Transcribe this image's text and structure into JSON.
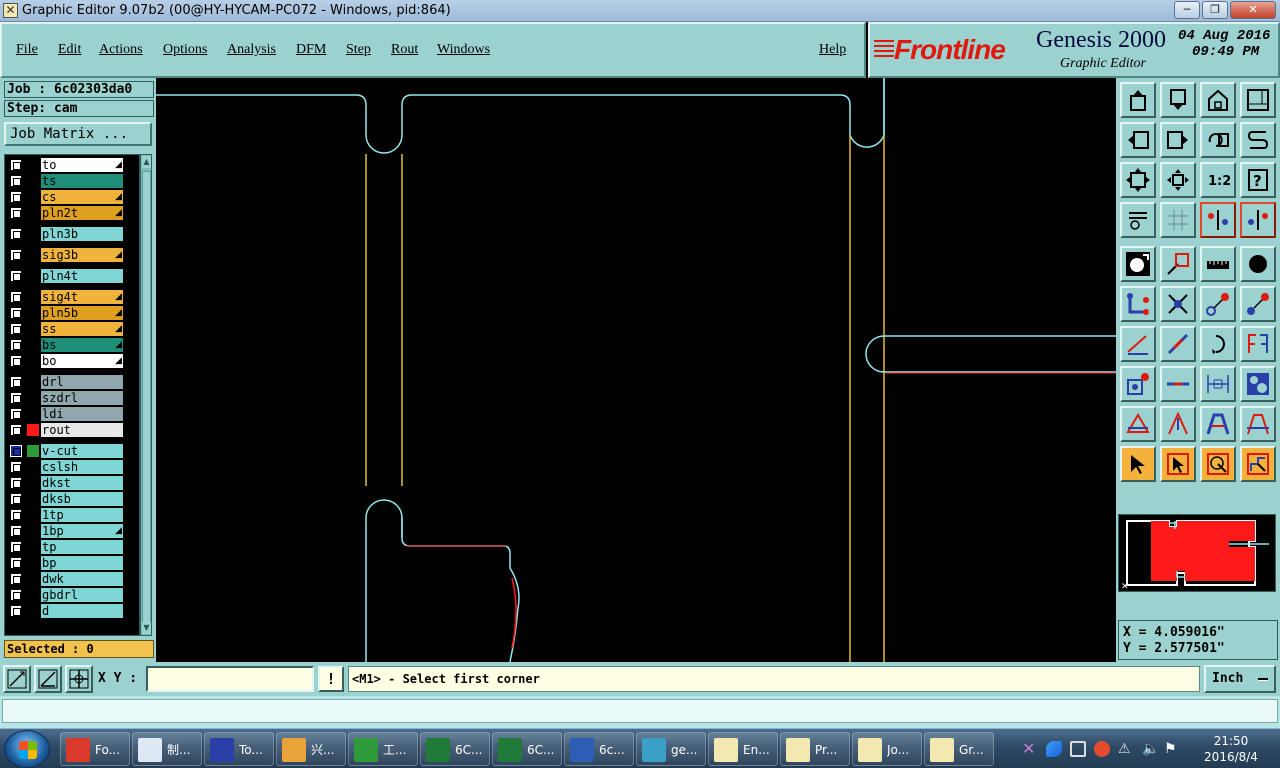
{
  "window": {
    "title": "Graphic Editor 9.07b2 (00@HY-HYCAM-PC072 - Windows, pid:864)",
    "controls": [
      "minimize",
      "maximize",
      "close"
    ]
  },
  "menu": {
    "file": "File",
    "edit": "Edit",
    "actions": "Actions",
    "options": "Options",
    "analysis": "Analysis",
    "dfm": "DFM",
    "step": "Step",
    "rout": "Rout",
    "windows": "Windows",
    "help": "Help"
  },
  "logo": {
    "brand": "Frontline",
    "product": "Genesis 2000",
    "subtitle": "Graphic Editor",
    "date": "04 Aug 2016",
    "time": "09:49 PM"
  },
  "job": {
    "job_line": "Job : 6c02303da0",
    "step_line": "Step: cam",
    "matrix_button": "Job Matrix ..."
  },
  "layers": [
    {
      "name": "to",
      "color": "#ffffff",
      "flag": true
    },
    {
      "name": "ts",
      "color": "#1f8f7a",
      "flag": false
    },
    {
      "name": "cs",
      "color": "#f0b43c",
      "flag": true
    },
    {
      "name": "pln2t",
      "color": "#e0a01f",
      "flag": true
    },
    {
      "name": "pln3b",
      "color": "#7fd6d4",
      "flag": false
    },
    {
      "name": "sig3b",
      "color": "#f0b43c",
      "flag": true
    },
    {
      "name": "pln4t",
      "color": "#7fd6d4",
      "flag": false
    },
    {
      "name": "sig4t",
      "color": "#f0b43c",
      "flag": true
    },
    {
      "name": "pln5b",
      "color": "#e0a01f",
      "flag": true
    },
    {
      "name": "ss",
      "color": "#f0b43c",
      "flag": true
    },
    {
      "name": "bs",
      "color": "#1f8f7a",
      "flag": true
    },
    {
      "name": "bo",
      "color": "#ffffff",
      "flag": true
    },
    {
      "name": "drl",
      "color": "#8fa7ad",
      "flag": false
    },
    {
      "name": "szdrl",
      "color": "#8fa7ad",
      "flag": false
    },
    {
      "name": "ldi",
      "color": "#8fa7ad",
      "flag": false
    },
    {
      "name": "rout",
      "color": "#e8e8e8",
      "flag": false,
      "mark": "#ff1a1a"
    },
    {
      "name": "v-cut",
      "color": "#7fd6d4",
      "flag": false,
      "mark": "#2f9a3a",
      "selected": true
    },
    {
      "name": "cslsh",
      "color": "#7fd6d4",
      "flag": false
    },
    {
      "name": "dkst",
      "color": "#7fd6d4",
      "flag": false
    },
    {
      "name": "dksb",
      "color": "#7fd6d4",
      "flag": false
    },
    {
      "name": "1tp",
      "color": "#7fd6d4",
      "flag": false
    },
    {
      "name": "1bp",
      "color": "#7fd6d4",
      "flag": true
    },
    {
      "name": "tp",
      "color": "#7fd6d4",
      "flag": false
    },
    {
      "name": "bp",
      "color": "#7fd6d4",
      "flag": false
    },
    {
      "name": "dwk",
      "color": "#7fd6d4",
      "flag": false
    },
    {
      "name": "gbdrl",
      "color": "#7fd6d4",
      "flag": false
    },
    {
      "name": "d",
      "color": "#7fd6d4",
      "flag": false
    }
  ],
  "selected_text": "Selected : 0",
  "coords": {
    "x_line": "X = 4.059016\"",
    "y_line": "Y = 2.577501\""
  },
  "status": {
    "xy_label": "X Y :",
    "xy_value": "",
    "excl_label": "!",
    "prompt": "<M1> - Select first corner",
    "unit": "Inch"
  },
  "taskbar": {
    "tasks": [
      {
        "label": "Fo...",
        "color": "#d93a2b"
      },
      {
        "label": "制...",
        "color": "#dfe9f5"
      },
      {
        "label": "To...",
        "color": "#2a3fa8"
      },
      {
        "label": "兴...",
        "color": "#e8a33a"
      },
      {
        "label": "工...",
        "color": "#2f9a3a"
      },
      {
        "label": "6C...",
        "color": "#1f7a3a"
      },
      {
        "label": "6C...",
        "color": "#1f7a3a"
      },
      {
        "label": "6c...",
        "color": "#2b5fb5"
      },
      {
        "label": "ge...",
        "color": "#3aa0c8"
      },
      {
        "label": "En...",
        "color": "#f3e8b0"
      },
      {
        "label": "Pr...",
        "color": "#f3e8b0"
      },
      {
        "label": "Jo...",
        "color": "#f3e8b0"
      },
      {
        "label": "Gr...",
        "color": "#f3e8b0"
      }
    ],
    "clock_time": "21:50",
    "clock_date": "2016/8/4"
  },
  "colors": {
    "panel": "#9bd2cf",
    "canvas_bg": "#000000",
    "outline_cyan": "#8fe8f0",
    "outline_yellow": "#e8b830",
    "rout_red": "#ff1a1a",
    "selected_bg": "#f1c24d",
    "prompt_bg": "#ffffe4"
  }
}
